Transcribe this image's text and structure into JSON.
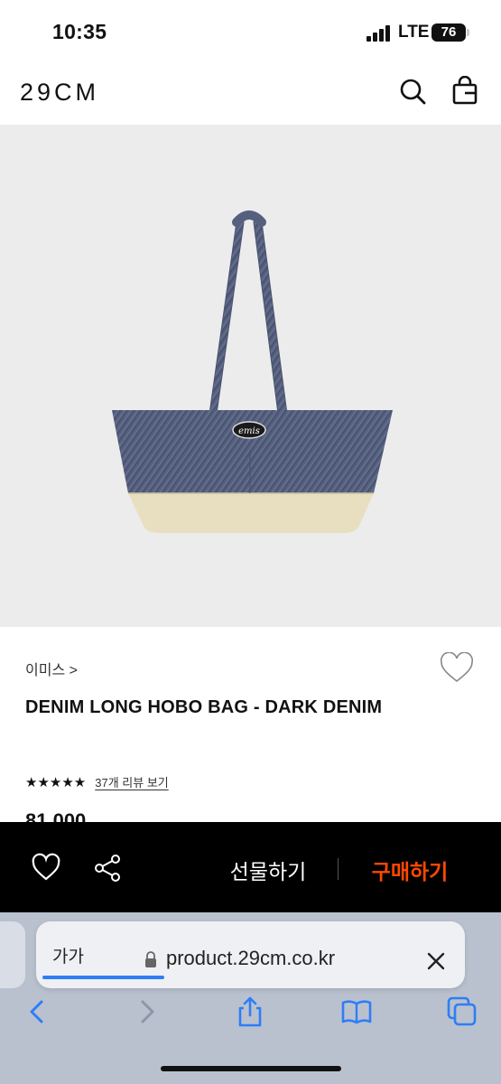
{
  "status_bar": {
    "time": "10:35",
    "network": "LTE",
    "battery": "76"
  },
  "header": {
    "logo": "29CM",
    "icons": [
      "search-icon",
      "shopping-bag-icon"
    ]
  },
  "product": {
    "image_alt_icon": "tote-bag-photo",
    "logo_patch_text": "emis",
    "brand": "이미스 >",
    "title": "DENIM LONG HOBO BAG - DARK DENIM",
    "stars": "★★★★★",
    "review_link": "37개 리뷰 보기",
    "price_partial": "81,000"
  },
  "action_bar": {
    "gift_label": "선물하기",
    "buy_label": "구매하기",
    "buy_color": "#ff4800",
    "icons": [
      "heart-icon",
      "share-icon"
    ]
  },
  "browser": {
    "aa_label": "가가",
    "url": "product.29cm.co.kr",
    "load_progress": 0.25,
    "accent": "#2f7df6",
    "toolbar_icons": [
      "back-icon",
      "forward-icon",
      "share-icon",
      "bookmarks-icon",
      "tabs-icon"
    ]
  }
}
